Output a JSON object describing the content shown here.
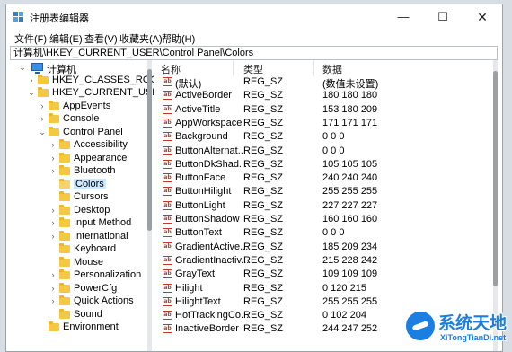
{
  "window": {
    "title": "注册表编辑器"
  },
  "titlebar": {
    "minimize": "—",
    "maximize": "☐",
    "close": "✕"
  },
  "menu": [
    "文件(F)",
    "编辑(E)",
    "查看(V)",
    "收藏夹(A)",
    "帮助(H)"
  ],
  "address": "计算机\\HKEY_CURRENT_USER\\Control Panel\\Colors",
  "tree": {
    "root": "计算机",
    "items": [
      {
        "label": "HKEY_CLASSES_ROOT",
        "expander": "›"
      },
      {
        "label": "HKEY_CURRENT_USER",
        "expander": "⌄"
      },
      {
        "label": "AppEvents",
        "expander": "›"
      },
      {
        "label": "Console",
        "expander": "›"
      },
      {
        "label": "Control Panel",
        "expander": "⌄"
      },
      {
        "label": "Accessibility",
        "expander": "›"
      },
      {
        "label": "Appearance",
        "expander": "›"
      },
      {
        "label": "Bluetooth",
        "expander": "›"
      },
      {
        "label": "Colors",
        "expander": "",
        "selected": true
      },
      {
        "label": "Cursors",
        "expander": ""
      },
      {
        "label": "Desktop",
        "expander": "›"
      },
      {
        "label": "Input Method",
        "expander": "›"
      },
      {
        "label": "International",
        "expander": "›"
      },
      {
        "label": "Keyboard",
        "expander": ""
      },
      {
        "label": "Mouse",
        "expander": ""
      },
      {
        "label": "Personalization",
        "expander": "›"
      },
      {
        "label": "PowerCfg",
        "expander": "›"
      },
      {
        "label": "Quick Actions",
        "expander": "›"
      },
      {
        "label": "Sound",
        "expander": ""
      },
      {
        "label": "Environment",
        "expander": ""
      }
    ]
  },
  "values": {
    "headers": {
      "name": "名称",
      "type": "类型",
      "data": "数据"
    },
    "icon_text": "ab",
    "rows": [
      {
        "name": "(默认)",
        "type": "REG_SZ",
        "data": "(数值未设置)"
      },
      {
        "name": "ActiveBorder",
        "type": "REG_SZ",
        "data": "180 180 180"
      },
      {
        "name": "ActiveTitle",
        "type": "REG_SZ",
        "data": "153 180 209"
      },
      {
        "name": "AppWorkspace",
        "type": "REG_SZ",
        "data": "171 171 171"
      },
      {
        "name": "Background",
        "type": "REG_SZ",
        "data": "0 0 0"
      },
      {
        "name": "ButtonAlternat...",
        "type": "REG_SZ",
        "data": "0 0 0"
      },
      {
        "name": "ButtonDkShad...",
        "type": "REG_SZ",
        "data": "105 105 105"
      },
      {
        "name": "ButtonFace",
        "type": "REG_SZ",
        "data": "240 240 240"
      },
      {
        "name": "ButtonHilight",
        "type": "REG_SZ",
        "data": "255 255 255"
      },
      {
        "name": "ButtonLight",
        "type": "REG_SZ",
        "data": "227 227 227"
      },
      {
        "name": "ButtonShadow",
        "type": "REG_SZ",
        "data": "160 160 160"
      },
      {
        "name": "ButtonText",
        "type": "REG_SZ",
        "data": "0 0 0"
      },
      {
        "name": "GradientActive...",
        "type": "REG_SZ",
        "data": "185 209 234"
      },
      {
        "name": "GradientInactiv...",
        "type": "REG_SZ",
        "data": "215 228 242"
      },
      {
        "name": "GrayText",
        "type": "REG_SZ",
        "data": "109 109 109"
      },
      {
        "name": "Hilight",
        "type": "REG_SZ",
        "data": "0 120 215"
      },
      {
        "name": "HilightText",
        "type": "REG_SZ",
        "data": "255 255 255"
      },
      {
        "name": "HotTrackingCo...",
        "type": "REG_SZ",
        "data": "0 102 204"
      },
      {
        "name": "InactiveBorder",
        "type": "REG_SZ",
        "data": "244 247 252"
      }
    ]
  },
  "watermark": {
    "title": "系统天地",
    "url": "XiTongTianDi.net"
  },
  "colors": {
    "selection": "#cde8ff",
    "folder": "#f5c842",
    "brand": "#1a7fe0"
  }
}
